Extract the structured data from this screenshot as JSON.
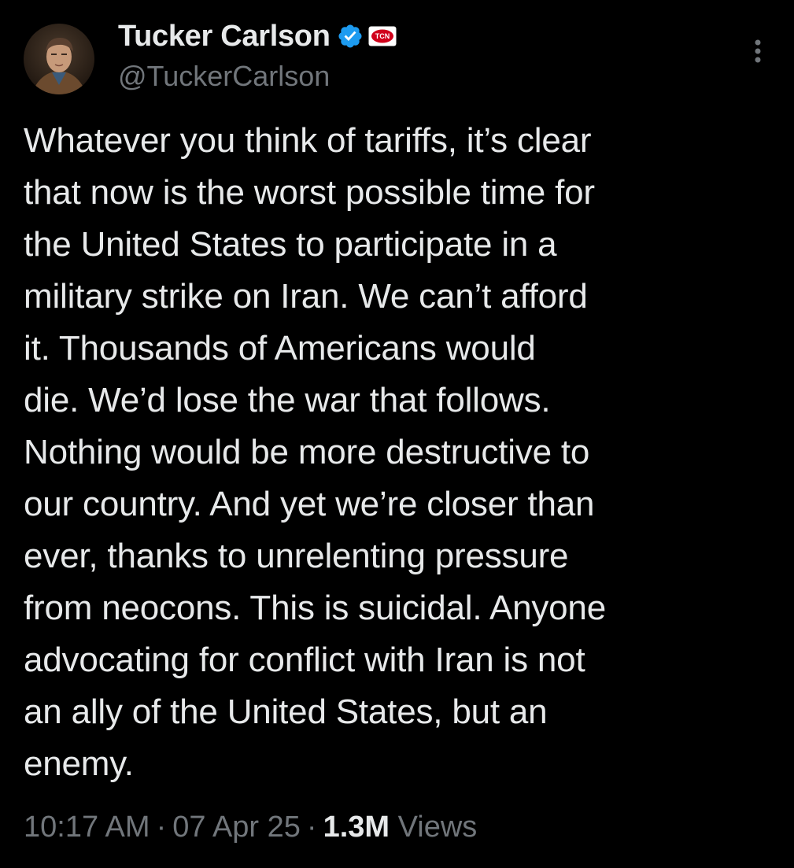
{
  "author": {
    "display_name": "Tucker Carlson",
    "handle": "@TuckerCarlson",
    "verified_color": "#1d9bf0",
    "affiliate_badge_text": "TCN"
  },
  "tweet": {
    "text": "Whatever you think of tariffs, it’s clear\nthat now is the worst possible time for\nthe United States to participate in a\nmilitary strike on Iran. We can’t afford\nit. Thousands of Americans would\ndie. We’d lose the war that follows.\nNothing would be more destructive to\nour country. And yet we’re closer than\never, thanks to unrelenting pressure\nfrom neocons. This is suicidal. Anyone\nadvocating for conflict with Iran is not\nan ally of the United States, but an\nenemy."
  },
  "meta": {
    "time": "10:17 AM",
    "separator": "·",
    "date": "07 Apr 25",
    "views_count": "1.3M",
    "views_label": "Views"
  },
  "icons": {
    "verified": "verified-badge-icon",
    "more": "more-vertical-icon",
    "affiliate": "affiliate-badge-icon"
  },
  "colors": {
    "background": "#000000",
    "text_primary": "#e7e9ea",
    "text_secondary": "#71767b",
    "accent": "#1d9bf0"
  }
}
